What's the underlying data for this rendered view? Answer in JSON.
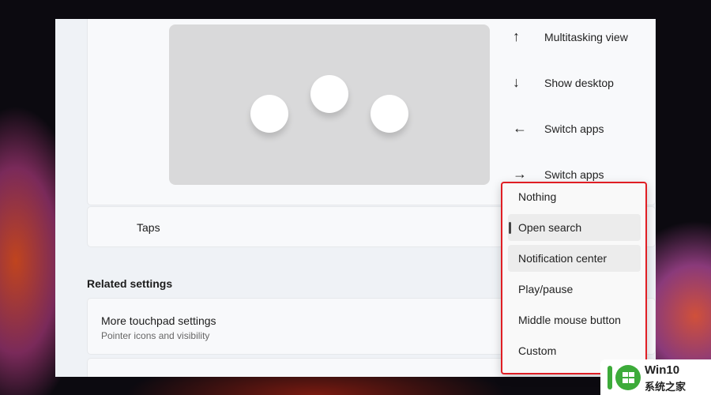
{
  "gestures": [
    {
      "icon": "arrow-up-icon",
      "glyph": "↑",
      "label": "Multitasking view"
    },
    {
      "icon": "arrow-down-icon",
      "glyph": "↓",
      "label": "Show desktop"
    },
    {
      "icon": "arrow-left-icon",
      "glyph": "←",
      "label": "Switch apps"
    },
    {
      "icon": "arrow-right-icon",
      "glyph": "→",
      "label": "Switch apps"
    }
  ],
  "taps": {
    "label": "Taps"
  },
  "related": {
    "heading": "Related settings",
    "items": [
      {
        "title": "More touchpad settings",
        "subtitle": "Pointer icons and visibility"
      }
    ]
  },
  "dropdown": {
    "options": [
      "Nothing",
      "Open search",
      "Notification center",
      "Play/pause",
      "Middle mouse button",
      "Custom"
    ],
    "selected": "Open search",
    "hovered": "Notification center",
    "highlight_color": "#e01e24"
  },
  "watermark": {
    "brand": "Win10",
    "sub": "系统之家"
  }
}
